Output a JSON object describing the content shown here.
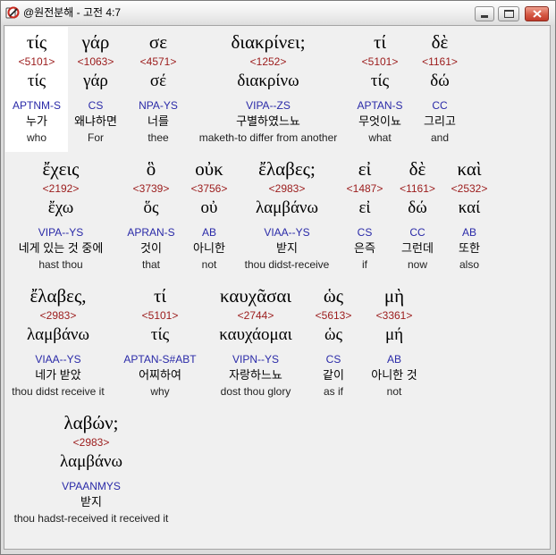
{
  "window": {
    "title": "@원전분해 - 고전 4:7",
    "icon": "app-icon",
    "buttons": {
      "minimize": "minimize-icon",
      "maximize": "maximize-icon",
      "close": "close-icon"
    }
  },
  "colors": {
    "background": "#f0f0f0",
    "selected_background": "#ffffff",
    "strongs": "#9b1b1b",
    "parsing": "#2a2aa8",
    "close_button": "#c23b2a"
  },
  "rows": [
    {
      "words": [
        {
          "greek": "τίς",
          "strongs": "<5101>",
          "lemma": "τίς",
          "parsing": "APTNM-S",
          "korean": "누가",
          "english": "who",
          "selected": true
        },
        {
          "greek": "γάρ",
          "strongs": "<1063>",
          "lemma": "γάρ",
          "parsing": "CS",
          "korean": "왜냐하면",
          "english": "For"
        },
        {
          "greek": "σε",
          "strongs": "<4571>",
          "lemma": "σέ",
          "parsing": "NPA-YS",
          "korean": "너를",
          "english": "thee"
        },
        {
          "greek": "διακρίνει;",
          "strongs": "<1252>",
          "lemma": "διακρίνω",
          "parsing": "VIPA--ZS",
          "korean": "구별하였느뇨",
          "english": "maketh-to differ from another"
        },
        {
          "greek": "τί",
          "strongs": "<5101>",
          "lemma": "τίς",
          "parsing": "APTAN-S",
          "korean": "무엇이뇨",
          "english": "what"
        },
        {
          "greek": "δὲ",
          "strongs": "<1161>",
          "lemma": "δώ",
          "parsing": "CC",
          "korean": "그리고",
          "english": "and"
        }
      ]
    },
    {
      "words": [
        {
          "greek": "ἔχεις",
          "strongs": "<2192>",
          "lemma": "ἔχω",
          "parsing": "VIPA--YS",
          "korean": "네게 있는 것 중에",
          "english": "hast thou"
        },
        {
          "greek": "ὃ",
          "strongs": "<3739>",
          "lemma": "ὅς",
          "parsing": "APRAN-S",
          "korean": "것이",
          "english": "that"
        },
        {
          "greek": "οὐκ",
          "strongs": "<3756>",
          "lemma": "οὐ",
          "parsing": "AB",
          "korean": "아니한",
          "english": "not"
        },
        {
          "greek": "ἔλαβες;",
          "strongs": "<2983>",
          "lemma": "λαμβάνω",
          "parsing": "VIAA--YS",
          "korean": "받지",
          "english": "thou didst-receive"
        },
        {
          "greek": "εἰ",
          "strongs": "<1487>",
          "lemma": "εἰ",
          "parsing": "CS",
          "korean": "은즉",
          "english": "if"
        },
        {
          "greek": "δὲ",
          "strongs": "<1161>",
          "lemma": "δώ",
          "parsing": "CC",
          "korean": "그런데",
          "english": "now"
        },
        {
          "greek": "καὶ",
          "strongs": "<2532>",
          "lemma": "καί",
          "parsing": "AB",
          "korean": "또한",
          "english": "also"
        }
      ]
    },
    {
      "words": [
        {
          "greek": "ἔλαβες,",
          "strongs": "<2983>",
          "lemma": "λαμβάνω",
          "parsing": "VIAA--YS",
          "korean": "네가 받았",
          "english": "thou didst receive it"
        },
        {
          "greek": "τί",
          "strongs": "<5101>",
          "lemma": "τίς",
          "parsing": "APTAN-S#ABT",
          "korean": "어찌하여",
          "english": "why"
        },
        {
          "greek": "καυχᾶσαι",
          "strongs": "<2744>",
          "lemma": "καυχάομαι",
          "parsing": "VIPN--YS",
          "korean": "자랑하느뇨",
          "english": "dost thou glory"
        },
        {
          "greek": "ὡς",
          "strongs": "<5613>",
          "lemma": "ὡς",
          "parsing": "CS",
          "korean": "같이",
          "english": "as if"
        },
        {
          "greek": "μὴ",
          "strongs": "<3361>",
          "lemma": "μή",
          "parsing": "AB",
          "korean": "아니한 것",
          "english": "not"
        }
      ]
    },
    {
      "words": [
        {
          "greek": "λαβών;",
          "strongs": "<2983>",
          "lemma": "λαμβάνω",
          "parsing": "VPAANMYS",
          "korean": "받지",
          "english": "thou hadst-received it received it"
        }
      ]
    }
  ]
}
